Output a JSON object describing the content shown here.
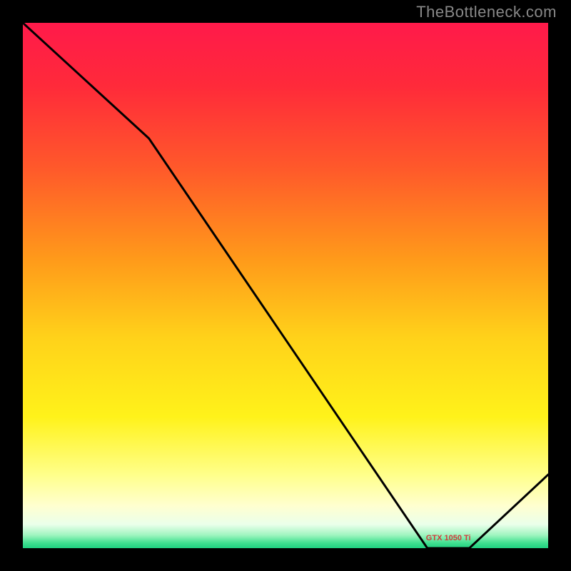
{
  "watermark": "TheBottleneck.com",
  "chart_data": {
    "type": "line",
    "title": "",
    "xlabel": "",
    "ylabel": "",
    "xlim": [
      0,
      100
    ],
    "ylim": [
      0,
      100
    ],
    "annotation_label": "GTX 1050 Ti",
    "series": [
      {
        "name": "curve",
        "x": [
          0,
          24,
          77,
          85,
          100
        ],
        "y": [
          100,
          78,
          0,
          0,
          14
        ]
      }
    ],
    "gradient_stops": [
      {
        "pos": 0.0,
        "color": "#ff1a4a"
      },
      {
        "pos": 0.12,
        "color": "#ff2a3a"
      },
      {
        "pos": 0.28,
        "color": "#ff5a2a"
      },
      {
        "pos": 0.45,
        "color": "#ff9a1a"
      },
      {
        "pos": 0.6,
        "color": "#ffd21a"
      },
      {
        "pos": 0.75,
        "color": "#fff21a"
      },
      {
        "pos": 0.86,
        "color": "#ffff8a"
      },
      {
        "pos": 0.92,
        "color": "#ffffd0"
      },
      {
        "pos": 0.955,
        "color": "#eaffea"
      },
      {
        "pos": 0.975,
        "color": "#a0f5c0"
      },
      {
        "pos": 0.99,
        "color": "#40e090"
      },
      {
        "pos": 1.0,
        "color": "#20d080"
      }
    ],
    "annotation": {
      "x": 81,
      "y": 1.5,
      "color": "#d03a3a"
    }
  }
}
